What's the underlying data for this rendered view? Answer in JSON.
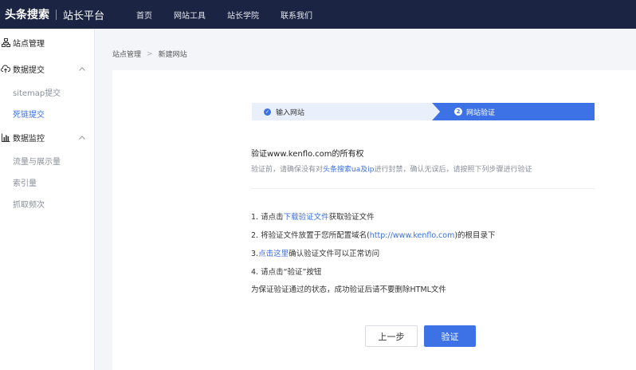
{
  "header": {
    "brand": "头条搜索",
    "brand_sub": "站长平台",
    "nav": [
      "首页",
      "网站工具",
      "站长学院",
      "联系我们"
    ]
  },
  "sidebar": {
    "site_manage": "站点管理",
    "data_submit": "数据提交",
    "sitemap": "sitemap提交",
    "deadlink": "死链提交",
    "data_monitor": "数据监控",
    "traffic": "流量与展示量",
    "index": "索引量",
    "crawl": "抓取频次"
  },
  "breadcrumb": {
    "parent": "站点管理",
    "arrow": ">",
    "current": "新建网站"
  },
  "steps": {
    "step1": "输入网站",
    "step2_num": "2",
    "step2": "网站验证"
  },
  "verify": {
    "title": "验证www.kenflo.com的所有权",
    "hint_before": "验证前，请确保没有对",
    "hint_link": "头条搜索ua及ip",
    "hint_after": "进行封禁，确认无误后，请按照下列步骤进行验证"
  },
  "instructions": {
    "i1_before": "1. 请点击",
    "i1_link": "下载验证文件",
    "i1_after": "获取验证文件",
    "i2_before": "2. 将验证文件放置于您所配置域名(",
    "i2_link": "http://www.kenflo.com",
    "i2_after": ")的根目录下",
    "i3_before": "3.",
    "i3_link": "点击这里",
    "i3_after": "确认验证文件可以正常访问",
    "i4": "4. 请点击“验证”按钮",
    "note": "为保证验证通过的状态，成功验证后请不要删除HTML文件"
  },
  "buttons": {
    "prev": "上一步",
    "verify": "验证"
  },
  "colors": {
    "topbar": "#1b2443",
    "accent": "#3d72e7",
    "link": "#3d6fe0"
  }
}
